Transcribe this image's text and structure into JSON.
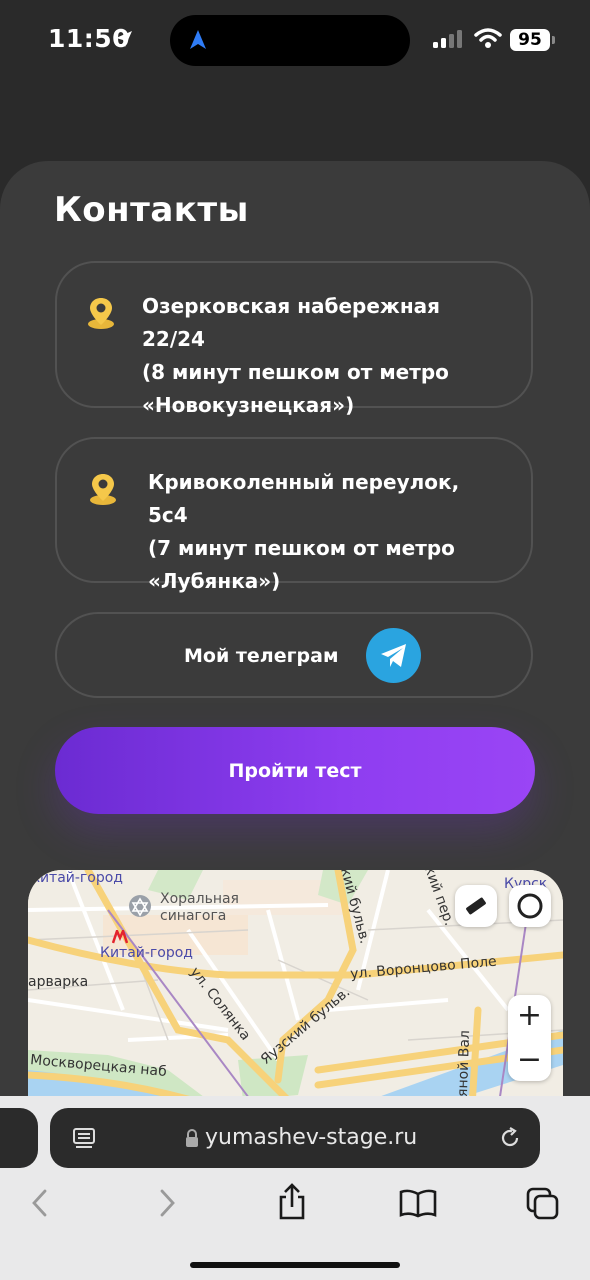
{
  "status_bar": {
    "time": "11:50",
    "battery": "95"
  },
  "contacts": {
    "title": "Контакты",
    "addresses": [
      {
        "line1": "Озерковская набережная",
        "line2": "22/24",
        "line3": "(8 минут пешком от метро",
        "line4": "«Новокузнецкая»)"
      },
      {
        "line1": "Кривоколенный переулок,",
        "line2": "5с4",
        "line3": "(7 минут пешком от метро",
        "line4": "«Лубянка»)"
      }
    ],
    "telegram_label": "Мой телеграм",
    "cta_label": "Пройти тест"
  },
  "map": {
    "labels": {
      "kitay_gorod_top": "Китай-город",
      "synagogue_1": "Хоральная",
      "synagogue_2": "синагога",
      "kitay_gorod_metro": "Китай-город",
      "varvarka": "арварка",
      "solyanka": "ул. Солянка",
      "yauzsky": "Яузский бульв.",
      "vorontsovo": "ул. Воронцово Поле",
      "boulevard": "ский бульв.",
      "per": "кий пер.",
      "moskvoretskaya": "Москворецкая наб",
      "val": "ляной Вал",
      "kursk": "Курск"
    },
    "zoom_in": "+",
    "zoom_out": "−",
    "icons": [
      "ruler-icon",
      "layers-icon",
      "synagogue-icon",
      "metro-icon"
    ]
  },
  "browser": {
    "url": "yumashev-stage.ru",
    "icons": [
      "reader-icon",
      "lock-icon",
      "reload-icon",
      "back-icon",
      "forward-icon",
      "share-icon",
      "bookmarks-icon",
      "tabs-icon"
    ]
  },
  "colors": {
    "accent_purple": "#8e3df0",
    "pin_yellow": "#f5c84a",
    "telegram_blue": "#2aa4e0",
    "card_bg": "#3b3b3b"
  }
}
